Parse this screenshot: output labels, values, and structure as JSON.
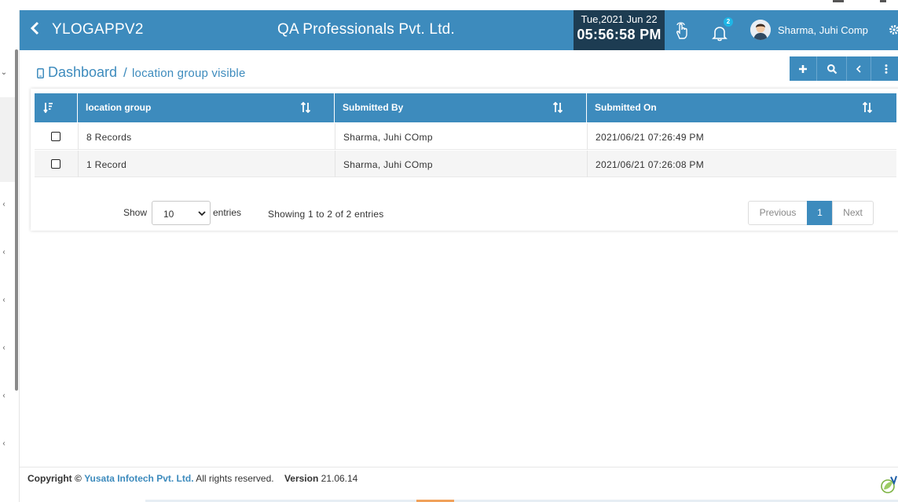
{
  "header": {
    "app_name": "YLOGAPPV2",
    "company": "QA Professionals Pvt. Ltd.",
    "date": "Tue,2021 Jun 22",
    "time": "05:56:58 PM",
    "notification_count": "2",
    "user_name": "Sharma, Juhi Comp"
  },
  "breadcrumb": {
    "main": "Dashboard",
    "separator": "/",
    "sub": "location group visible"
  },
  "table": {
    "columns": [
      "location group",
      "Submitted By",
      "Submitted On"
    ],
    "rows": [
      {
        "location_group": "8 Records",
        "submitted_by": "Sharma, Juhi COmp",
        "submitted_on": "2021/06/21 07:26:49 PM"
      },
      {
        "location_group": "1 Record",
        "submitted_by": "Sharma, Juhi COmp",
        "submitted_on": "2021/06/21 07:26:08 PM"
      }
    ]
  },
  "pagination": {
    "show_label": "Show",
    "page_size": "10",
    "entries_label": "entries",
    "info": "Showing 1 to 2 of 2 entries",
    "previous": "Previous",
    "current_page": "1",
    "next": "Next"
  },
  "footer": {
    "copyright_label": "Copyright ©",
    "company_link": "Yusata Infotech Pvt. Ltd.",
    "rights": "All rights reserved.",
    "version_label": "Version",
    "version": "21.06.14"
  },
  "colors": {
    "header_blue": "#3d8bbd",
    "clock_bg": "#1d3c52",
    "badge": "#1eb6e6"
  },
  "icons": {
    "back": "chevron-left-icon",
    "touch": "hand-pointer-icon",
    "notifications": "bell-icon",
    "settings": "gear-icon",
    "add": "plus-icon",
    "search": "search-icon",
    "collapse": "chevron-left-icon",
    "more": "ellipsis-vertical-icon",
    "sort": "sort-icon"
  }
}
